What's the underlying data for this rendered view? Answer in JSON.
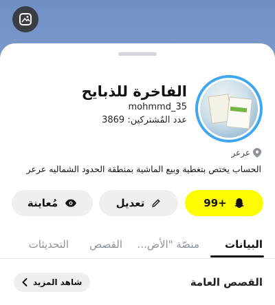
{
  "profile": {
    "name": "الفاخرة للذبايح",
    "username": "mohmmd_35",
    "subscribers_label": "عدد المُشتركين: 3869",
    "location": "عرعر",
    "bio": "الحساب يختص بتغطية وبيع الماشية بمنطقة الحدود الشماليه عرعر"
  },
  "actions": {
    "snap_label": "+99",
    "edit_label": "تعديل",
    "preview_label": "مُعاينة"
  },
  "tabs": [
    {
      "label": "البيانات",
      "active": true
    },
    {
      "label": "منصّة \"الأض...",
      "active": false
    },
    {
      "label": "القصص",
      "active": false
    },
    {
      "label": "التحديثات",
      "active": false
    }
  ],
  "section": {
    "title": "القصص العامة",
    "see_more_label": "شاهد المزيد"
  },
  "colors": {
    "snap_yellow": "#fffc00",
    "ring_blue": "#3fa7f0"
  }
}
